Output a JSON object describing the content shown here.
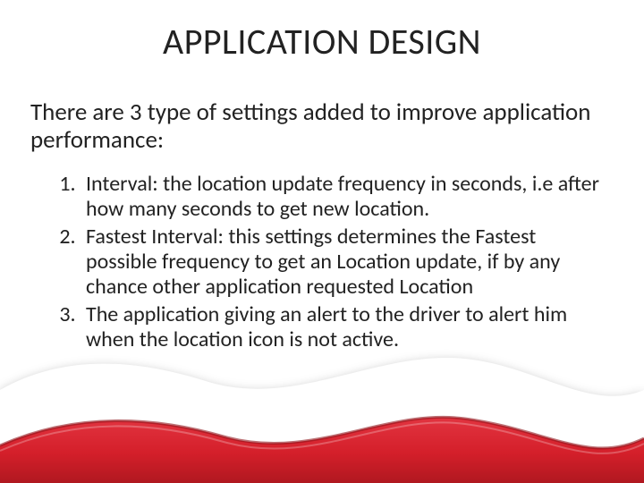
{
  "title": "APPLICATION DESIGN",
  "intro": "There are 3 type of settings added to improve application performance:",
  "items": [
    "Interval: the location update frequency in seconds, i.e after how many seconds to get new location.",
    "Fastest Interval: this settings determines the Fastest possible frequency to get an Location update, if by any chance other application requested Location",
    "The application giving an alert to the driver to alert him when the location icon is not active."
  ],
  "colors": {
    "wave_red": "#d41f2a",
    "wave_dark": "#9e1820",
    "shadow": "rgba(0,0,0,0.35)"
  }
}
